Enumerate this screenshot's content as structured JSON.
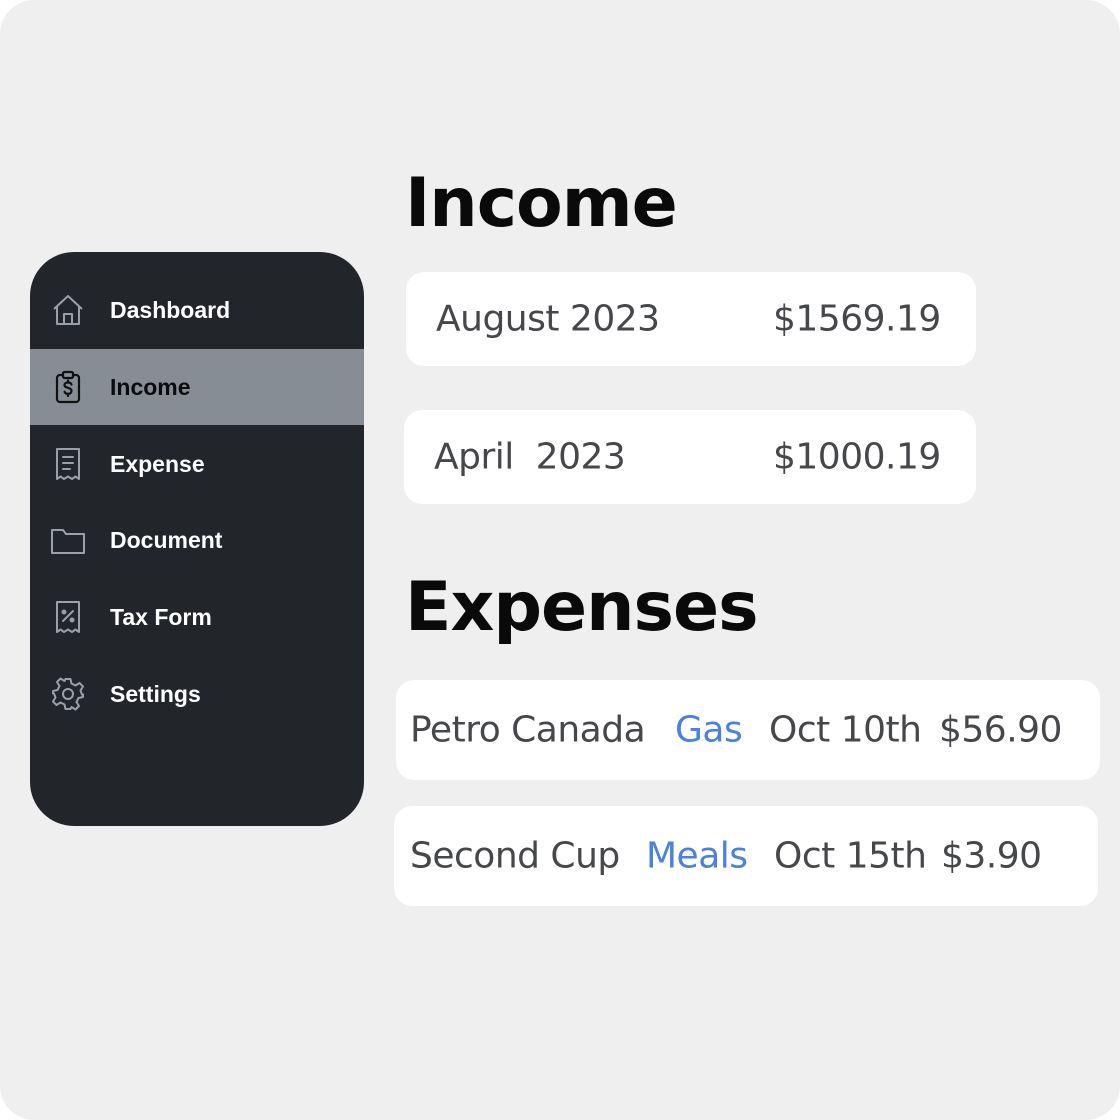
{
  "sidebar": {
    "items": [
      {
        "label": "Dashboard",
        "icon": "home-icon"
      },
      {
        "label": "Income",
        "icon": "clipboard-dollar-icon",
        "active": true
      },
      {
        "label": "Expense",
        "icon": "receipt-icon"
      },
      {
        "label": "Document",
        "icon": "folder-icon"
      },
      {
        "label": "Tax Form",
        "icon": "tax-receipt-icon"
      },
      {
        "label": "Settings",
        "icon": "gear-icon"
      }
    ]
  },
  "income": {
    "title": "Income",
    "entries": [
      {
        "month": "August 2023",
        "amount": "$1569.19"
      },
      {
        "month": "April  2023",
        "amount": "$1000.19"
      }
    ]
  },
  "expenses": {
    "title": "Expenses",
    "entries": [
      {
        "vendor": "Petro Canada",
        "category": "Gas",
        "date": "Oct 10th",
        "amount": "$56.90"
      },
      {
        "vendor": "Second Cup",
        "category": "Meals",
        "date": "Oct 15th",
        "amount": "$3.90"
      }
    ]
  },
  "colors": {
    "background": "#efefef",
    "sidebar": "#22252a",
    "active_item": "#878d95",
    "category": "#4a80e0",
    "card_text": "#45474b"
  }
}
